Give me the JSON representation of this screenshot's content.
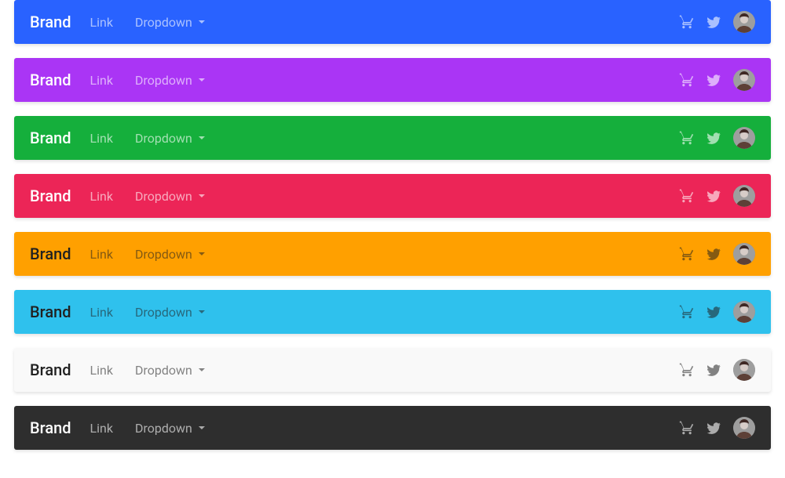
{
  "brand_label": "Brand",
  "link_label": "Link",
  "dropdown_label": "Dropdown",
  "icons": {
    "cart": "cart-icon",
    "twitter": "twitter-icon",
    "avatar": "avatar"
  },
  "navbars": [
    {
      "bg": "#2962ff",
      "text": "light"
    },
    {
      "bg": "#aa35f5",
      "text": "light"
    },
    {
      "bg": "#15af3c",
      "text": "light"
    },
    {
      "bg": "#ec2557",
      "text": "light"
    },
    {
      "bg": "#ffa000",
      "text": "dark"
    },
    {
      "bg": "#2fc1ed",
      "text": "dark"
    },
    {
      "bg": "#f9f9f9",
      "text": "dark"
    },
    {
      "bg": "#2e2e2e",
      "text": "light"
    }
  ]
}
